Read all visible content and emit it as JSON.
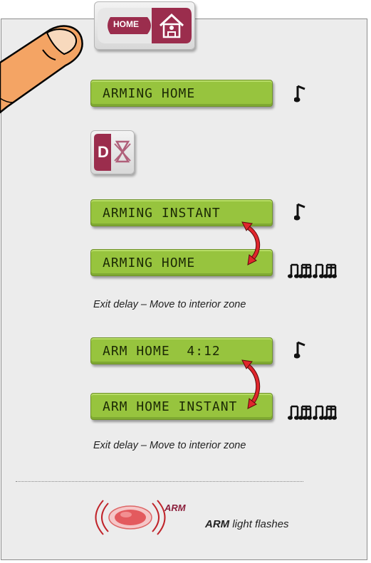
{
  "home_key": {
    "label": "HOME"
  },
  "lcd": {
    "step1": "ARMING HOME",
    "step2a": "ARMING INSTANT",
    "step2b": "ARMING HOME",
    "step3a": "ARM HOME  4:12",
    "step3b": "ARM HOME INSTANT"
  },
  "instant_key": {
    "label": "D"
  },
  "captions": {
    "exit_delay_1": "Exit delay – Move to interior zone",
    "exit_delay_2": "Exit delay – Move to interior zone"
  },
  "arm_indicator": {
    "tag": "ARM",
    "caption_bold": "ARM",
    "caption_rest": " light flashes"
  },
  "icons": {
    "single_note": "single-note-icon",
    "note_sequence": "beamed-notes-icon",
    "swap_arrow": "double-curved-arrow-icon"
  },
  "colors": {
    "lcd": "#97c43e",
    "lcd_text": "#1c2a05",
    "arrow": "#e0262c",
    "home_key": "#9b2d4d",
    "arm_light": "#e35a5e"
  }
}
